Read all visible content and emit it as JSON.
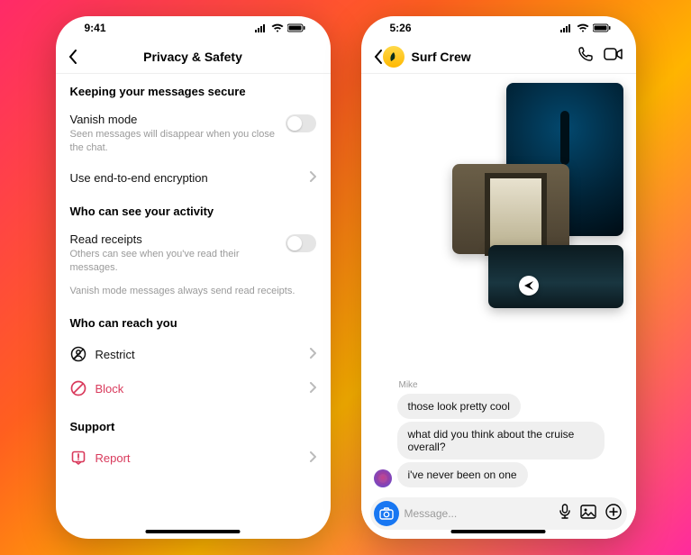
{
  "phone1": {
    "time": "9:41",
    "title": "Privacy & Safety",
    "sections": {
      "secure": {
        "heading": "Keeping your messages secure",
        "vanish": {
          "title": "Vanish mode",
          "sub": "Seen messages will disappear when you close the chat."
        },
        "e2e": {
          "title": "Use end-to-end encryption"
        }
      },
      "activity": {
        "heading": "Who can see your activity",
        "receipts": {
          "title": "Read receipts",
          "sub": "Others can see when you've read their messages."
        },
        "note": "Vanish mode messages always send read receipts."
      },
      "reach": {
        "heading": "Who can reach you",
        "restrict": "Restrict",
        "block": "Block"
      },
      "support": {
        "heading": "Support",
        "report": "Report"
      }
    }
  },
  "phone2": {
    "time": "5:26",
    "chat_title": "Surf Crew",
    "sender": "Mike",
    "messages": {
      "m1": "those look pretty cool",
      "m2": "what did you think about the cruise overall?",
      "m3": "i've never been on one"
    },
    "composer_placeholder": "Message..."
  }
}
